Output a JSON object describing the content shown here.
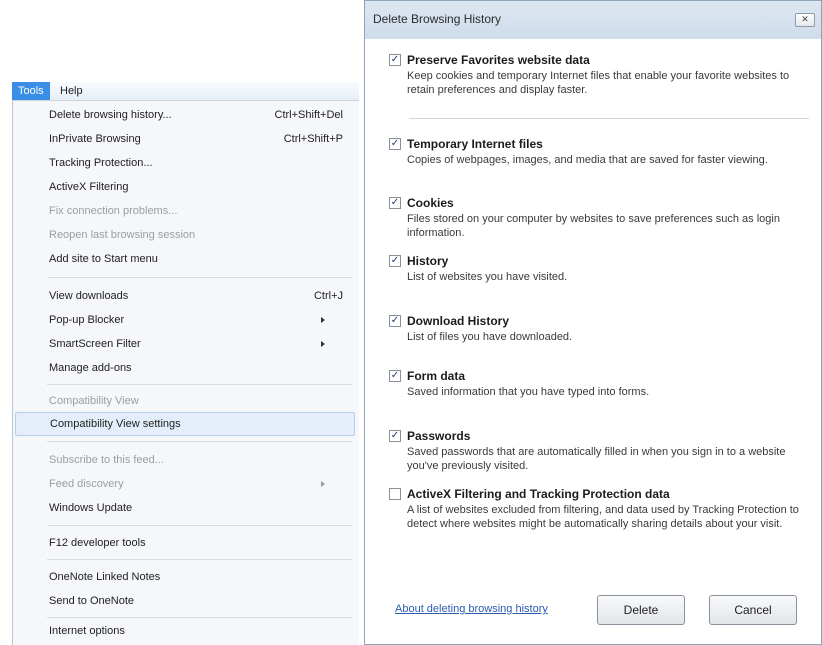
{
  "menubar": {
    "tools": "Tools",
    "help": "Help"
  },
  "menu": {
    "delete_history": "Delete browsing history...",
    "delete_history_sc": "Ctrl+Shift+Del",
    "inprivate": "InPrivate Browsing",
    "inprivate_sc": "Ctrl+Shift+P",
    "tracking": "Tracking Protection...",
    "activex": "ActiveX Filtering",
    "fix_conn": "Fix connection problems...",
    "reopen": "Reopen last browsing session",
    "add_site": "Add site to Start menu",
    "downloads": "View downloads",
    "downloads_sc": "Ctrl+J",
    "popup": "Pop-up Blocker",
    "smartscreen": "SmartScreen Filter",
    "addons": "Manage add-ons",
    "compat_view": "Compatibility View",
    "compat_settings": "Compatibility View settings",
    "subscribe": "Subscribe to this feed...",
    "feed_discovery": "Feed discovery",
    "windows_update": "Windows Update",
    "f12": "F12 developer tools",
    "onenote_linked": "OneNote Linked Notes",
    "send_onenote": "Send to OneNote",
    "internet_options": "Internet options"
  },
  "dialog": {
    "title": "Delete Browsing History",
    "close_glyph": "✕",
    "options": [
      {
        "title": "Preserve Favorites website data",
        "desc": "Keep cookies and temporary Internet files that enable your favorite websites to retain preferences and display faster.",
        "checked": true
      },
      {
        "title": "Temporary Internet files",
        "desc": "Copies of webpages, images, and media that are saved for faster viewing.",
        "checked": true
      },
      {
        "title": "Cookies",
        "desc": "Files stored on your computer by websites to save preferences such as login information.",
        "checked": true
      },
      {
        "title": "History",
        "desc": "List of websites you have visited.",
        "checked": true
      },
      {
        "title": "Download History",
        "desc": "List of files you have downloaded.",
        "checked": true
      },
      {
        "title": "Form data",
        "desc": "Saved information that you have typed into forms.",
        "checked": true
      },
      {
        "title": "Passwords",
        "desc": "Saved passwords that are automatically filled in when you sign in to a website you've previously visited.",
        "checked": true
      },
      {
        "title": "ActiveX Filtering and Tracking Protection data",
        "desc": "A list of websites excluded from filtering, and data used by Tracking Protection to detect where websites might be automatically sharing details about your visit.",
        "checked": false
      }
    ],
    "check_glyph": "✓",
    "about_link": "About deleting browsing history",
    "delete_button": "Delete",
    "cancel_button": "Cancel"
  }
}
